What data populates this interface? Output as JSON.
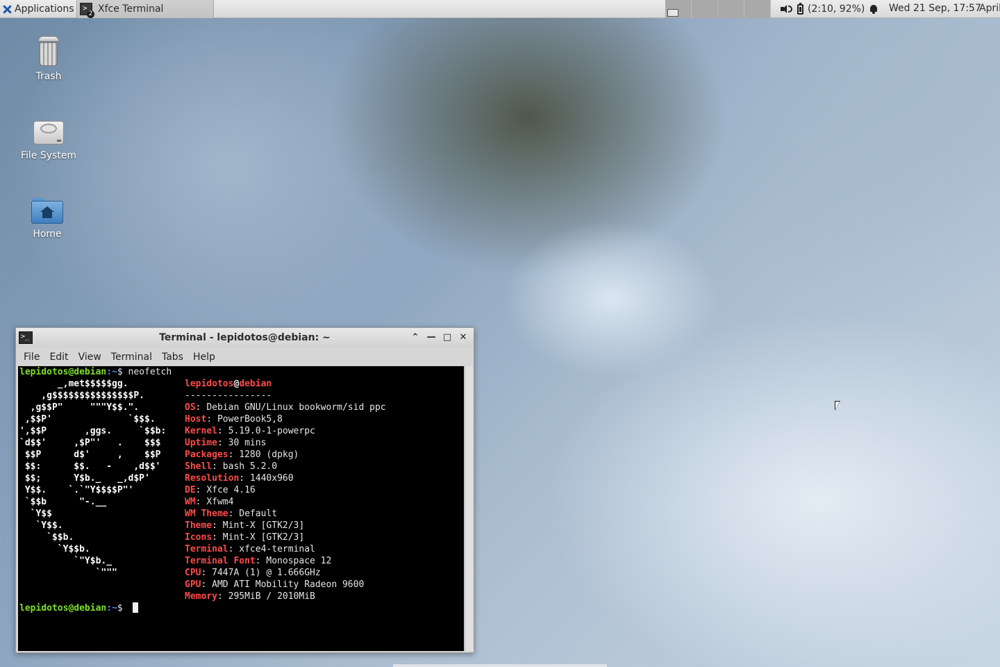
{
  "panel": {
    "applications_label": "Applications ⠿",
    "task_title": "Xfce Terminal",
    "task_badge": "2",
    "battery_text": "(2:10, 92%)",
    "clock": "Wed 21 Sep, 17:57",
    "user": "April"
  },
  "desktop": {
    "icons": [
      {
        "label": "Trash",
        "icon": "trash-icon"
      },
      {
        "label": "File System",
        "icon": "drive-icon"
      },
      {
        "label": "Home",
        "icon": "home-folder-icon"
      }
    ]
  },
  "terminal": {
    "title": "Terminal - lepidotos@debian: ~",
    "menu": [
      "File",
      "Edit",
      "View",
      "Terminal",
      "Tabs",
      "Help"
    ],
    "prompt_user": "lepidotos@debian",
    "prompt_path": ":~",
    "prompt_symbol": "$ ",
    "command": "neofetch",
    "info_header_user": "lepidotos",
    "info_header_at": "@",
    "info_header_host": "debian",
    "separator": "----------------",
    "info": [
      {
        "key": "OS",
        "value": "Debian GNU/Linux bookworm/sid ppc"
      },
      {
        "key": "Host",
        "value": "PowerBook5,8"
      },
      {
        "key": "Kernel",
        "value": "5.19.0-1-powerpc"
      },
      {
        "key": "Uptime",
        "value": "30 mins"
      },
      {
        "key": "Packages",
        "value": "1280 (dpkg)"
      },
      {
        "key": "Shell",
        "value": "bash 5.2.0"
      },
      {
        "key": "Resolution",
        "value": "1440x960"
      },
      {
        "key": "DE",
        "value": "Xfce 4.16"
      },
      {
        "key": "WM",
        "value": "Xfwm4"
      },
      {
        "key": "WM Theme",
        "value": "Default"
      },
      {
        "key": "Theme",
        "value": "Mint-X [GTK2/3]"
      },
      {
        "key": "Icons",
        "value": "Mint-X [GTK2/3]"
      },
      {
        "key": "Terminal",
        "value": "xfce4-terminal"
      },
      {
        "key": "Terminal Font",
        "value": "Monospace 12"
      },
      {
        "key": "CPU",
        "value": "7447A (1) @ 1.666GHz"
      },
      {
        "key": "GPU",
        "value": "AMD ATI Mobility Radeon 9600"
      },
      {
        "key": "Memory",
        "value": "295MiB / 2010MiB"
      }
    ],
    "logo_lines": [
      "       _,met$$$$$gg.",
      "    ,g$$$$$$$$$$$$$$$P.",
      "  ,g$$P\"     \"\"\"Y$$.\".",
      " ,$$P'              `$$$.",
      "',$$P       ,ggs.     `$$b:",
      "`d$$'     ,$P\"'   .    $$$",
      " $$P      d$'     ,    $$P",
      " $$:      $$.   -    ,d$$'",
      " $$;      Y$b._   _,d$P'",
      " Y$$.    `.`\"Y$$$$P\"'",
      " `$$b      \"-.__",
      "  `Y$$",
      "   `Y$$.",
      "     `$$b.",
      "       `Y$$b.",
      "          `\"Y$b._",
      "              `\"\"\""
    ]
  }
}
